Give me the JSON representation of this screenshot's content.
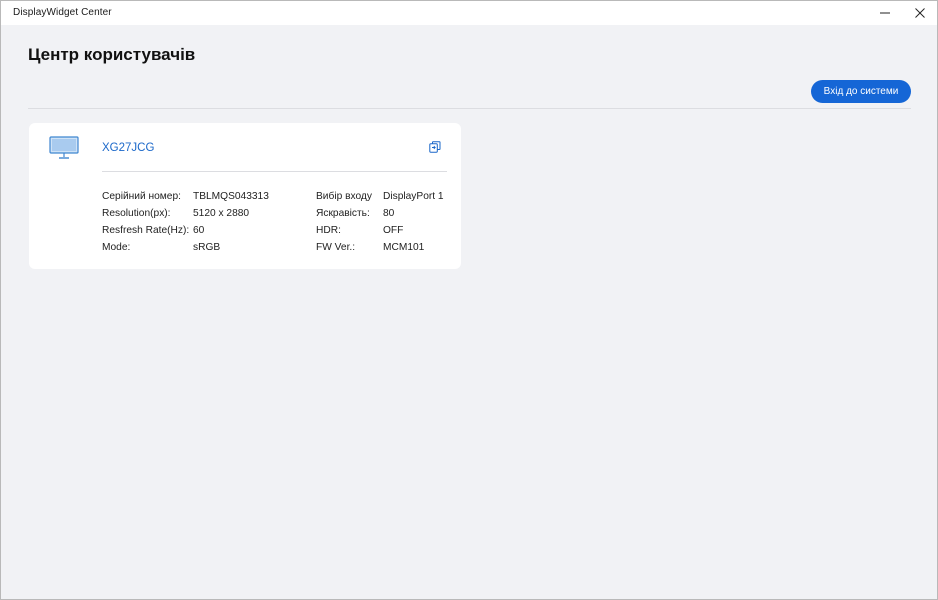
{
  "window": {
    "title": "DisplayWidget Center"
  },
  "page": {
    "title": "Центр користувачів"
  },
  "login_button": {
    "label": "Вхід до системи"
  },
  "device": {
    "model": "XG27JCG",
    "icons": {
      "device": "monitor-icon",
      "action": "copy-icon"
    },
    "left_info": [
      {
        "label": "Серійний номер:",
        "value": "TBLMQS043313"
      },
      {
        "label": "Resolution(px):",
        "value": "5120 x 2880"
      },
      {
        "label": "Resfresh Rate(Hz):",
        "value": "60"
      },
      {
        "label": "Mode:",
        "value": "sRGB"
      }
    ],
    "right_info": [
      {
        "label": "Вибір входу",
        "value": "DisplayPort 1"
      },
      {
        "label": "Яскравість:",
        "value": "80"
      },
      {
        "label": "HDR:",
        "value": "OFF"
      },
      {
        "label": "FW Ver.:",
        "value": "MCM101"
      }
    ]
  },
  "colors": {
    "accent": "#1566d6",
    "link": "#1a67c9",
    "background": "#f1f2f5",
    "card": "#ffffff"
  }
}
